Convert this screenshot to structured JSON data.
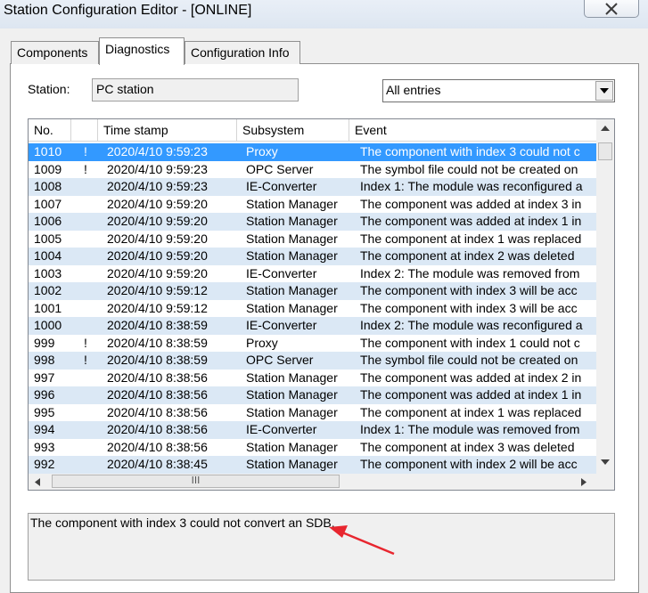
{
  "window": {
    "title": "Station Configuration Editor - [ONLINE]"
  },
  "tabs": [
    {
      "label": "Components",
      "active": false
    },
    {
      "label": "Diagnostics",
      "active": true
    },
    {
      "label": "Configuration Info",
      "active": false
    }
  ],
  "station": {
    "label": "Station:",
    "value": "PC station"
  },
  "filter": {
    "selected": "All entries"
  },
  "columns": {
    "no": "No.",
    "flag": "",
    "time": "Time stamp",
    "subsystem": "Subsystem",
    "event": "Event"
  },
  "rows": [
    {
      "no": "1010",
      "flag": "!",
      "time": "2020/4/10 9:59:23",
      "subsystem": "Proxy",
      "event": "The component with index 3 could not c"
    },
    {
      "no": "1009",
      "flag": "!",
      "time": "2020/4/10 9:59:23",
      "subsystem": "OPC Server",
      "event": "The symbol file could not be created on"
    },
    {
      "no": "1008",
      "flag": "",
      "time": "2020/4/10 9:59:23",
      "subsystem": "IE-Converter",
      "event": "Index 1: The module was reconfigured a"
    },
    {
      "no": "1007",
      "flag": "",
      "time": "2020/4/10 9:59:20",
      "subsystem": "Station Manager",
      "event": "The component was added at index 3 in"
    },
    {
      "no": "1006",
      "flag": "",
      "time": "2020/4/10 9:59:20",
      "subsystem": "Station Manager",
      "event": "The component was added at index 1 in"
    },
    {
      "no": "1005",
      "flag": "",
      "time": "2020/4/10 9:59:20",
      "subsystem": "Station Manager",
      "event": "The component at index 1 was replaced"
    },
    {
      "no": "1004",
      "flag": "",
      "time": "2020/4/10 9:59:20",
      "subsystem": "Station Manager",
      "event": "The component at index 2 was deleted"
    },
    {
      "no": "1003",
      "flag": "",
      "time": "2020/4/10 9:59:20",
      "subsystem": "IE-Converter",
      "event": "Index 2: The module was removed from"
    },
    {
      "no": "1002",
      "flag": "",
      "time": "2020/4/10 9:59:12",
      "subsystem": "Station Manager",
      "event": "The component with index 3 will be acc"
    },
    {
      "no": "1001",
      "flag": "",
      "time": "2020/4/10 9:59:12",
      "subsystem": "Station Manager",
      "event": "The component with index 3 will be acc"
    },
    {
      "no": "1000",
      "flag": "",
      "time": "2020/4/10 8:38:59",
      "subsystem": "IE-Converter",
      "event": "Index 2: The module was reconfigured a"
    },
    {
      "no": "999",
      "flag": "!",
      "time": "2020/4/10 8:38:59",
      "subsystem": "Proxy",
      "event": "The component with index 1 could not c"
    },
    {
      "no": "998",
      "flag": "!",
      "time": "2020/4/10 8:38:59",
      "subsystem": "OPC Server",
      "event": "The symbol file could not be created on"
    },
    {
      "no": "997",
      "flag": "",
      "time": "2020/4/10 8:38:56",
      "subsystem": "Station Manager",
      "event": "The component was added at index 2 in"
    },
    {
      "no": "996",
      "flag": "",
      "time": "2020/4/10 8:38:56",
      "subsystem": "Station Manager",
      "event": "The component was added at index 1 in"
    },
    {
      "no": "995",
      "flag": "",
      "time": "2020/4/10 8:38:56",
      "subsystem": "Station Manager",
      "event": "The component at index 1 was replaced"
    },
    {
      "no": "994",
      "flag": "",
      "time": "2020/4/10 8:38:56",
      "subsystem": "IE-Converter",
      "event": "Index 1: The module was removed from"
    },
    {
      "no": "993",
      "flag": "",
      "time": "2020/4/10 8:38:56",
      "subsystem": "Station Manager",
      "event": "The component at index 3 was deleted"
    },
    {
      "no": "992",
      "flag": "",
      "time": "2020/4/10 8:38:45",
      "subsystem": "Station Manager",
      "event": "The component with index 2 will be acc"
    }
  ],
  "detail": {
    "text": "The component with index 3 could not convert an SDB."
  },
  "scroll": {
    "thumb_label": "III"
  },
  "icons": {
    "close": "close-icon",
    "dropdown": "chevron-down-icon"
  },
  "colors": {
    "selection": "#3399ff",
    "alt_row": "#dbe8f5",
    "annotation": "#e8262f"
  }
}
